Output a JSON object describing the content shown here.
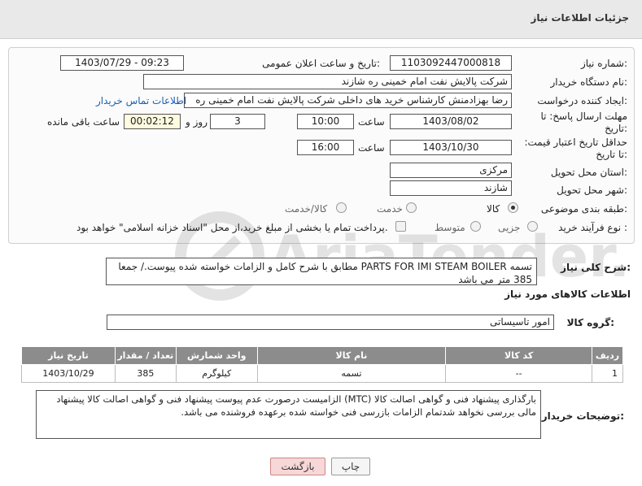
{
  "header": {
    "title": "جزئیات اطلاعات نیاز"
  },
  "form": {
    "need_number": {
      "label": "شماره نیاز:",
      "value": "1103092447000818"
    },
    "announce_datetime": {
      "label": "تاریخ و ساعت اعلان عمومی:",
      "value": "1403/07/29 - 09:23"
    },
    "buyer_org": {
      "label": "نام دستگاه خریدار:",
      "value": "شرکت پالایش نفت امام خمینی  ره  شازند"
    },
    "requester": {
      "label": "ایجاد کننده درخواست:",
      "value": "رضا بهزادمنش کارشناس خرید های داخلی  شرکت پالایش نفت امام خمینی  ره",
      "contact_link": "اطلاعات تماس خریدار"
    },
    "reply_deadline": {
      "label": "مهلت ارسال پاسخ: تا تاریخ:",
      "date": "1403/08/02",
      "time_label": "ساعت",
      "time": "10:00",
      "days": "3",
      "days_label": "روز و",
      "remaining": "00:02:12",
      "remaining_label": "ساعت باقی مانده"
    },
    "price_validity": {
      "label": "حداقل تاریخ اعتبار قیمت: تا تاریخ:",
      "date": "1403/10/30",
      "time_label": "ساعت",
      "time": "16:00"
    },
    "province": {
      "label": "استان محل تحویل:",
      "value": "مرکزی"
    },
    "city": {
      "label": "شهر محل تحویل:",
      "value": "شازند"
    },
    "category": {
      "label": "طبقه بندی موضوعی:",
      "options": [
        "کالا",
        "خدمت",
        "کالا/خدمت"
      ],
      "selected": "کالا"
    },
    "purchase_type": {
      "label": "نوع فرآیند خرید :",
      "options": [
        "جزیی",
        "متوسط"
      ],
      "selected": "",
      "checkbox_text": "پرداخت تمام یا بخشی از مبلغ خرید،از محل \"اسناد خزانه اسلامی\" خواهد بود."
    }
  },
  "summary": {
    "label": "شرح کلی نیاز:",
    "text": "تسمه PARTS FOR IMI STEAM BOILER  مطابق با شرح کامل و الزامات خواسته شده پیوست./ جمعا 385 متر می باشد"
  },
  "goods_section": {
    "title": "اطلاعات کالاهای مورد نیاز",
    "group_label": "گروه کالا:",
    "group_value": "امور تاسیساتی",
    "table": {
      "headers": [
        "ردیف",
        "کد کالا",
        "نام کالا",
        "واحد شمارش",
        "تعداد / مقدار",
        "تاریخ نیاز"
      ],
      "rows": [
        [
          "1",
          "--",
          "تسمه",
          "کیلوگرم",
          "385",
          "1403/10/29"
        ]
      ]
    }
  },
  "buyer_notes": {
    "label": "توضیحات خریدار:",
    "text": "بارگذاری پیشنهاد فنی و گواهی اصالت کالا (MTC)  الزامیست درصورت عدم پیوست پیشنهاد فنی و گواهی اصالت کالا پیشنهاد مالی بررسی نخواهد شدتمام الزامات بازرسی فنی خواسته شده برعهده فروشنده می باشد."
  },
  "buttons": {
    "print": "چاپ",
    "back": "بازگشت"
  },
  "watermark": {
    "text": "AriaTender.net"
  },
  "colors": {
    "table_header": "#8c8c8c",
    "link": "#1a5fb4",
    "back_button": "#f7d7d7"
  }
}
